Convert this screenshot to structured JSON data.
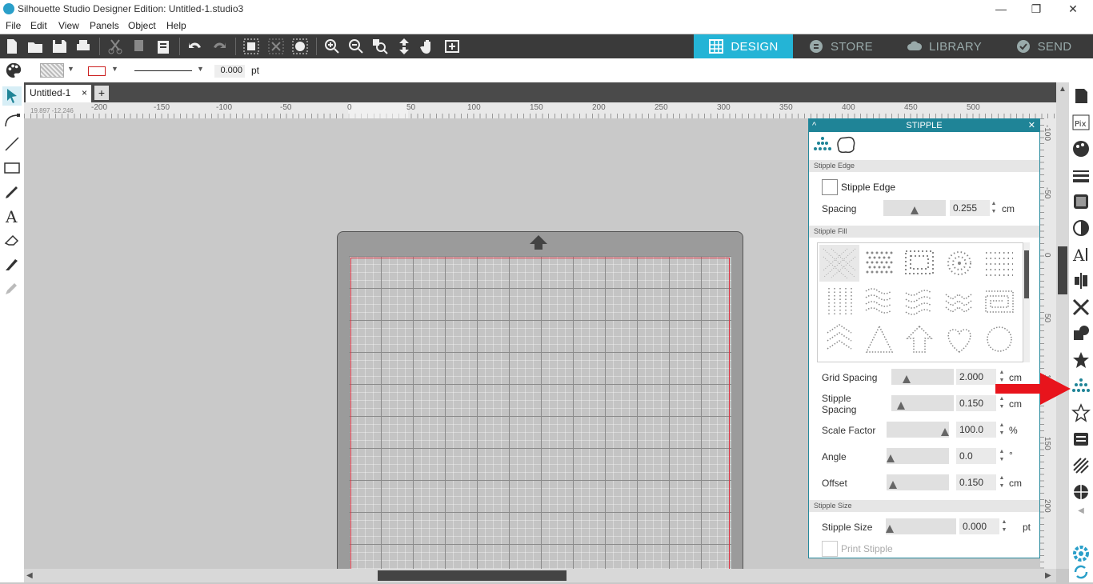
{
  "window": {
    "title": "Silhouette Studio Designer Edition: Untitled-1.studio3",
    "minimize": "—",
    "restore": "❐",
    "close": "✕"
  },
  "menu": [
    "File",
    "Edit",
    "View",
    "Panels",
    "Object",
    "Help"
  ],
  "nav_tabs": [
    {
      "label": "DESIGN",
      "active": true
    },
    {
      "label": "STORE",
      "active": false
    },
    {
      "label": "LIBRARY",
      "active": false
    },
    {
      "label": "SEND",
      "active": false
    }
  ],
  "toolbar2": {
    "line_width": "0.000",
    "line_unit": "pt"
  },
  "document_tab": {
    "name": "Untitled-1",
    "close": "×",
    "add": "+"
  },
  "coords": "19.897  -12.246",
  "hruler_ticks": [
    "-200",
    "-150",
    "-100",
    "-50",
    "0",
    "50",
    "100",
    "150",
    "200",
    "250",
    "300",
    "350",
    "400",
    "450",
    "500"
  ],
  "vruler_ticks": [
    "-100",
    "-50",
    "0",
    "50",
    "100",
    "150",
    "200"
  ],
  "panel": {
    "title": "STIPPLE",
    "collapse": "^",
    "close": "✕",
    "sections": {
      "edge": "Stipple Edge",
      "fill": "Stipple Fill",
      "size": "Stipple Size"
    },
    "edge_checkbox_label": "Stipple Edge",
    "spacing": {
      "label": "Spacing",
      "value": "0.255",
      "unit": "cm",
      "level": 0.5
    },
    "grid_spacing": {
      "label": "Grid Spacing",
      "value": "2.000",
      "unit": "cm",
      "level": 0.2
    },
    "stipple_spacing": {
      "label1": "Stipple",
      "label2": "Spacing",
      "value": "0.150",
      "unit": "cm",
      "level": 0.1
    },
    "scale_factor": {
      "label": "Scale Factor",
      "value": "100.0",
      "unit": "%",
      "level": 1.0
    },
    "angle": {
      "label": "Angle",
      "value": "0.0",
      "unit": "°",
      "level": 0.0
    },
    "offset": {
      "label": "Offset",
      "value": "0.150",
      "unit": "cm",
      "level": 0.05
    },
    "stipple_size": {
      "label": "Stipple Size",
      "value": "0.000",
      "unit": "pt",
      "level": 0.0
    },
    "print_stipple": "Print Stipple",
    "spin_up": "▲",
    "spin_down": "▼"
  },
  "colors": {
    "accent": "#24b4d6",
    "panel_header": "#1f8497",
    "toolbar": "#3a3a3a",
    "highlight_arrow": "#e8141c"
  }
}
